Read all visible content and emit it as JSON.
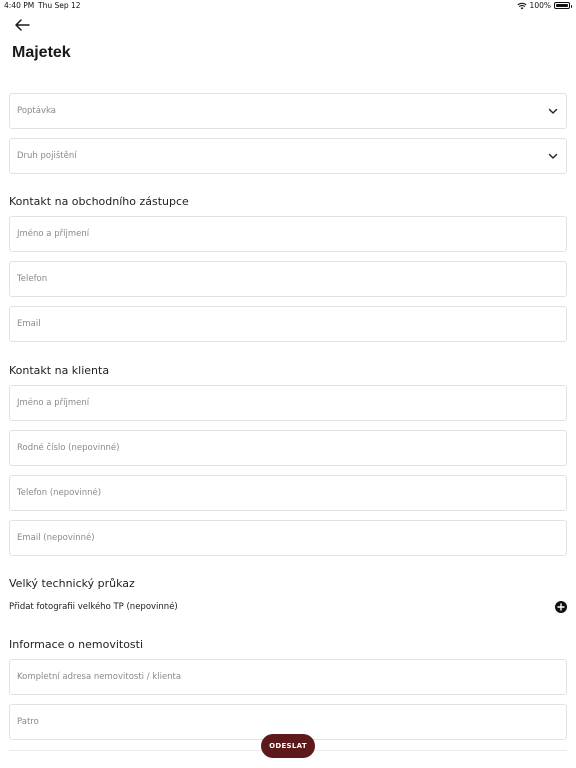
{
  "status_bar": {
    "time": "4:40 PM",
    "date": "Thu Sep 12",
    "battery": "100%"
  },
  "header": {
    "title": "Majetek"
  },
  "selects": [
    {
      "placeholder": "Poptávka"
    },
    {
      "placeholder": "Druh pojištění"
    }
  ],
  "sections": {
    "agent": {
      "title": "Kontakt na obchodního zástupce",
      "fields": [
        "Jméno a příjmení",
        "Telefon",
        "Email"
      ]
    },
    "client": {
      "title": "Kontakt na klienta",
      "fields": [
        "Jméno a příjmení",
        "Rodné číslo (nepovinné)",
        "Telefon (nepovinné)",
        "Email (nepovinné)"
      ]
    },
    "tp": {
      "title": "Velký technický průkaz",
      "add_photo_label": "Přidat fotografii velkého TP (nepovinné)"
    },
    "property": {
      "title": "Informace o nemovitosti",
      "fields": [
        "Kompletní adresa nemovitosti / klienta",
        "Patro"
      ]
    }
  },
  "submit_label": "ODESLAT",
  "colors": {
    "accent": "#5e1a1a",
    "border": "#e2e2e2",
    "placeholder": "#8a8a8a"
  }
}
